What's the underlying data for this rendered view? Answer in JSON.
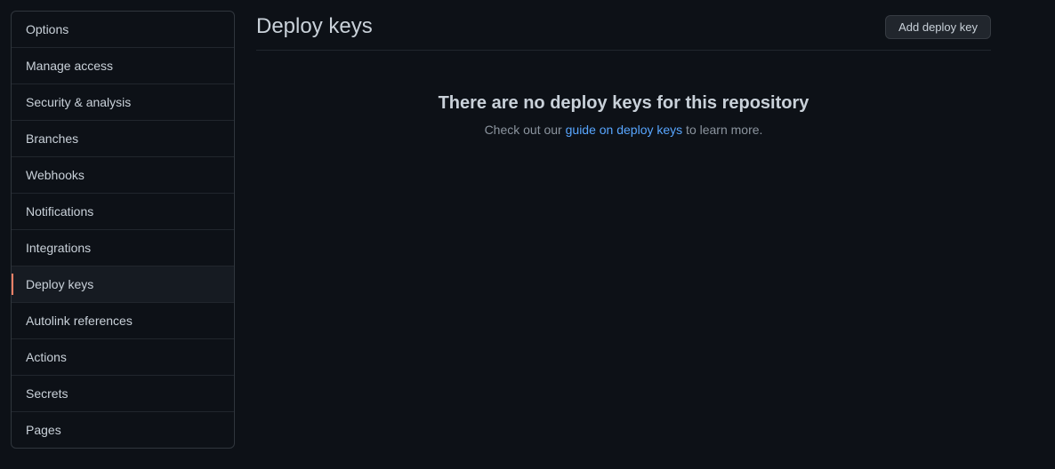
{
  "sidebar": {
    "items": [
      {
        "label": "Options",
        "active": false
      },
      {
        "label": "Manage access",
        "active": false
      },
      {
        "label": "Security & analysis",
        "active": false
      },
      {
        "label": "Branches",
        "active": false
      },
      {
        "label": "Webhooks",
        "active": false
      },
      {
        "label": "Notifications",
        "active": false
      },
      {
        "label": "Integrations",
        "active": false
      },
      {
        "label": "Deploy keys",
        "active": true
      },
      {
        "label": "Autolink references",
        "active": false
      },
      {
        "label": "Actions",
        "active": false
      },
      {
        "label": "Secrets",
        "active": false
      },
      {
        "label": "Pages",
        "active": false
      }
    ]
  },
  "header": {
    "title": "Deploy keys",
    "add_button_label": "Add deploy key"
  },
  "empty_state": {
    "heading": "There are no deploy keys for this repository",
    "text_prefix": "Check out our ",
    "link_text": "guide on deploy keys",
    "text_suffix": " to learn more."
  }
}
